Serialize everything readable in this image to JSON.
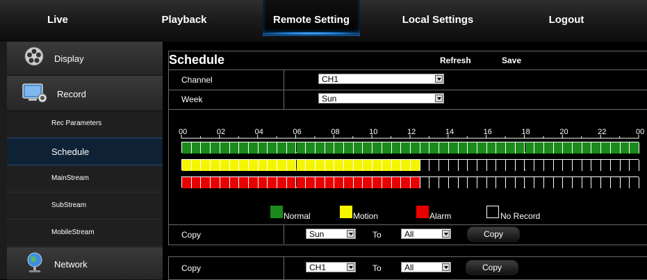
{
  "nav": {
    "tabs": [
      {
        "label": "Live"
      },
      {
        "label": "Playback"
      },
      {
        "label": "Remote Setting"
      },
      {
        "label": "Local Settings"
      },
      {
        "label": "Logout"
      }
    ]
  },
  "sidebar": {
    "sections": [
      {
        "label": "Display"
      },
      {
        "label": "Record"
      },
      {
        "label": "Network"
      }
    ],
    "record_items": [
      {
        "label": "Rec Parameters"
      },
      {
        "label": "Schedule"
      },
      {
        "label": "MainStream"
      },
      {
        "label": "SubStream"
      },
      {
        "label": "MobileStream"
      }
    ]
  },
  "page": {
    "title": "Schedule",
    "refresh_label": "Refresh",
    "save_label": "Save"
  },
  "form": {
    "channel_label": "Channel",
    "channel_value": "CH1",
    "week_label": "Week",
    "week_value": "Sun"
  },
  "timeline": {
    "hour_labels": [
      "00",
      "02",
      "04",
      "06",
      "08",
      "10",
      "12",
      "14",
      "16",
      "18",
      "20",
      "22",
      "00"
    ],
    "cells_per_row": 48,
    "normal_filled_cells": 48,
    "motion_filled_cells": 25,
    "alarm_filled_cells": 25
  },
  "legend": {
    "normal": "Normal",
    "motion": "Motion",
    "alarm": "Alarm",
    "no_record": "No Record"
  },
  "copy_row_1": {
    "label": "Copy",
    "from_value": "Sun",
    "to_label": "To",
    "to_value": "All",
    "button_label": "Copy"
  },
  "copy_row_2": {
    "label": "Copy",
    "from_value": "CH1",
    "to_label": "To",
    "to_value": "All",
    "button_label": "Copy"
  },
  "colors": {
    "normal": "#1a8a1a",
    "motion": "#f5f500",
    "alarm": "#e80000",
    "no_record": "#000000",
    "accent": "#1e7fd8"
  }
}
